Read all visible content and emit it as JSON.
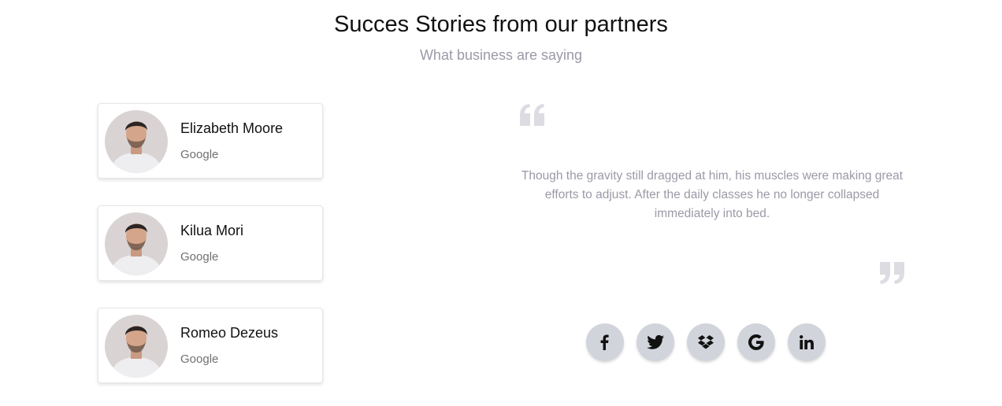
{
  "header": {
    "title": "Succes Stories from our partners",
    "subtitle": "What business are saying"
  },
  "testimonials": [
    {
      "name": "Elizabeth Moore",
      "company": "Google"
    },
    {
      "name": "Kilua Mori",
      "company": "Google"
    },
    {
      "name": "Romeo Dezeus",
      "company": "Google"
    }
  ],
  "quote": {
    "text": "Though the gravity still dragged at him, his muscles were making great efforts to adjust. After the daily classes he no longer collapsed immediately into bed."
  },
  "socials": [
    {
      "icon": "facebook-icon"
    },
    {
      "icon": "twitter-icon"
    },
    {
      "icon": "dropbox-icon"
    },
    {
      "icon": "google-icon"
    },
    {
      "icon": "linkedin-icon"
    }
  ],
  "colors": {
    "title": "#111111",
    "muted_text": "#9a9aa8",
    "quote_mark": "#dcdce2",
    "social_bg": "#d2d4dc",
    "card_border": "#e6e6ea"
  }
}
